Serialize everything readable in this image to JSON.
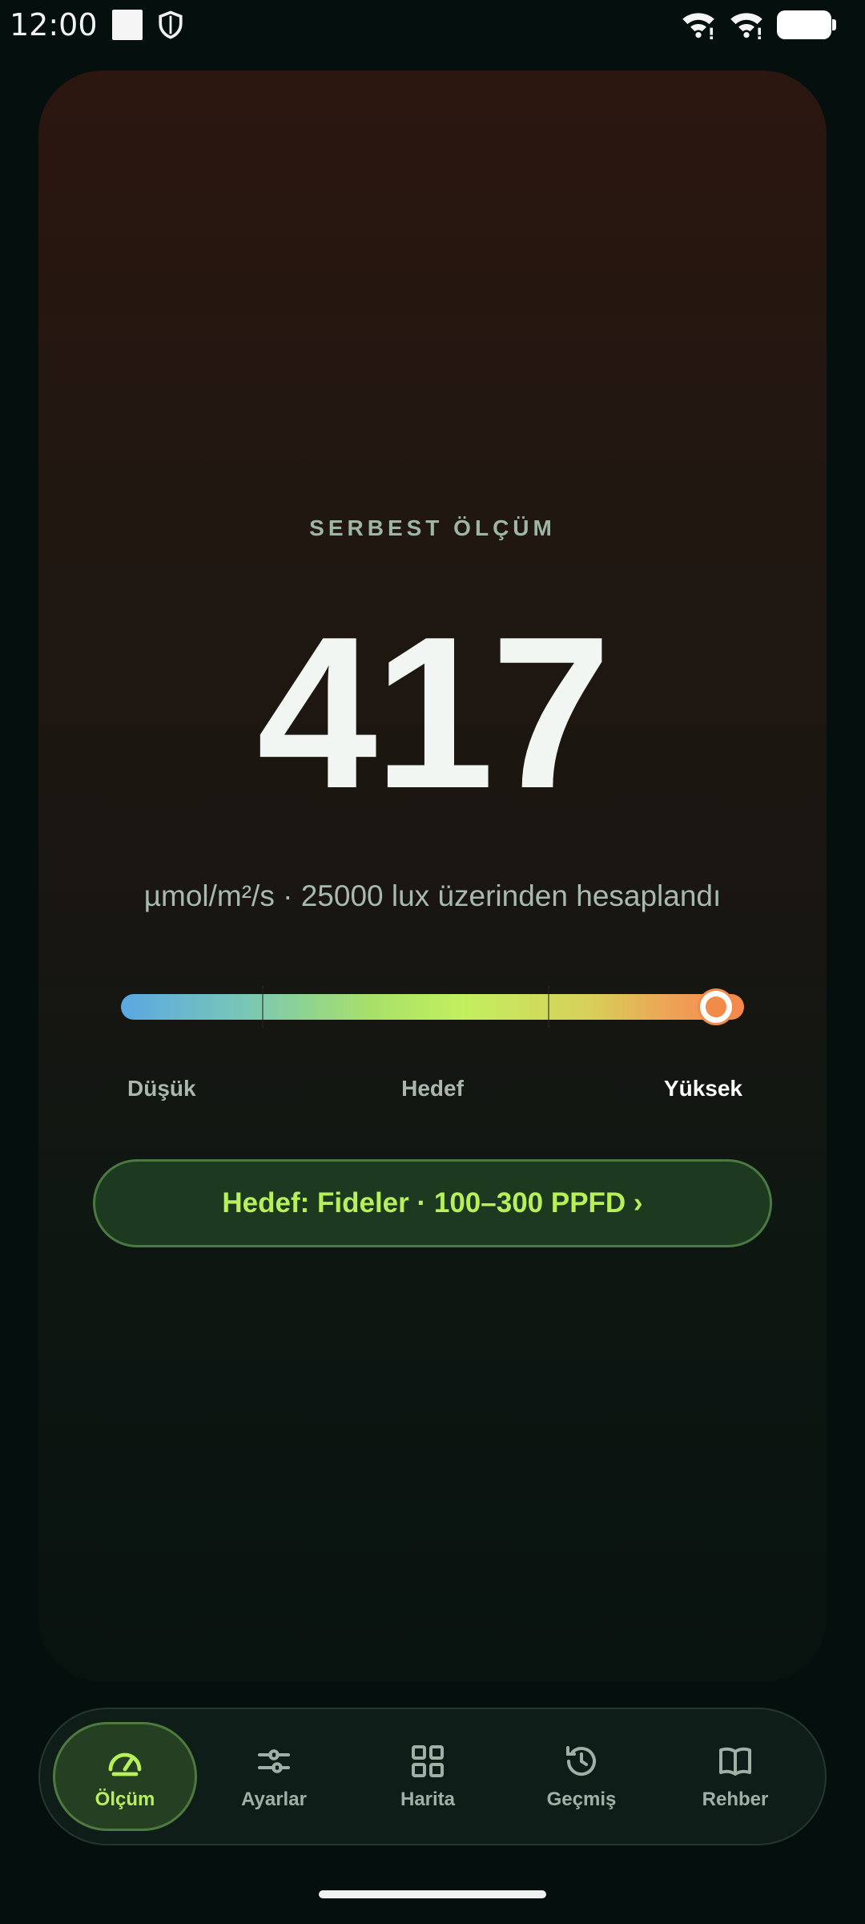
{
  "status": {
    "time": "12:00"
  },
  "measurement": {
    "mode": "SERBEST ÖLÇÜM",
    "value": "417",
    "unit_note": "µmol/m²/s · 25000 lux üzerinden hesaplandı",
    "gauge_level_percent": 95.5
  },
  "gauge_labels": {
    "low": "Düşük",
    "target": "Hedef",
    "high": "Yüksek"
  },
  "target_button": "Hedef: Fideler · 100–300 PPFD ›",
  "nav": [
    {
      "label": "Ölçüm",
      "icon": "gauge-icon",
      "active": true
    },
    {
      "label": "Ayarlar",
      "icon": "sliders-icon",
      "active": false
    },
    {
      "label": "Harita",
      "icon": "grid-icon",
      "active": false
    },
    {
      "label": "Geçmiş",
      "icon": "history-icon",
      "active": false
    },
    {
      "label": "Rehber",
      "icon": "book-icon",
      "active": false
    }
  ],
  "colors": {
    "accent": "#b7f05a",
    "background": "#050f0d",
    "card_top": "#2c1610",
    "high_indicator": "#f28a4a"
  }
}
